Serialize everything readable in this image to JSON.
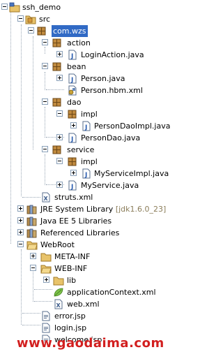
{
  "tree": {
    "project": "ssh_demo",
    "src": "src",
    "pkg_com_wzs": "com.wzs",
    "pkg_action": "action",
    "file_loginaction": "LoginAction.java",
    "pkg_bean": "bean",
    "file_person_java": "Person.java",
    "file_person_hbm": "Person.hbm.xml",
    "pkg_dao": "dao",
    "pkg_dao_impl": "impl",
    "file_persondaoimpl": "PersonDaoImpl.java",
    "file_persondao": "PersonDao.java",
    "pkg_service": "service",
    "pkg_service_impl": "impl",
    "file_myserviceimpl": "MyServiceImpl.java",
    "file_myservice": "MyService.java",
    "file_struts": "struts.xml",
    "lib_jre": "JRE System Library",
    "lib_jre_version": "[jdk1.6.0_23]",
    "lib_javaee": "Java EE 5 Libraries",
    "lib_referenced": "Referenced Libraries",
    "webroot": "WebRoot",
    "metainf": "META-INF",
    "webinf": "WEB-INF",
    "lib": "lib",
    "file_appcontext": "applicationContext.xml",
    "file_webxml": "web.xml",
    "file_errorjsp": "error.jsp",
    "file_loginjsp": "login.jsp",
    "file_welcomejsp": "welcome.jsp"
  },
  "watermark": "www.gaodaima.com",
  "colors": {
    "selection": "#316ac5",
    "package_icon": "#c08a3e",
    "folder_icon": "#e8c36a",
    "java_file_icon": "#2a5db0",
    "library_icon": "#b38b4d",
    "watermark": "#d21f1f"
  }
}
